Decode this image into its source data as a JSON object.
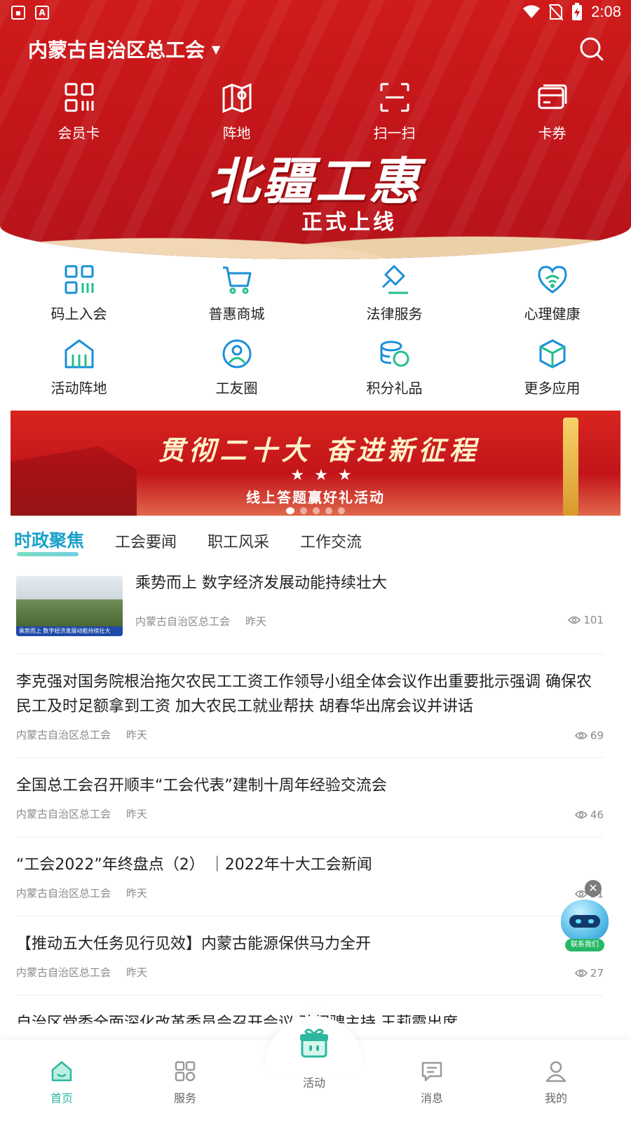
{
  "status_bar": {
    "time": "2:08",
    "icons": [
      "image-icon",
      "font-icon",
      "wifi-icon",
      "no-sim-icon",
      "battery-charging-icon"
    ]
  },
  "header": {
    "org_name": "内蒙古自治区总工会",
    "quick_nav": [
      {
        "label": "会员卡",
        "icon": "member-card-icon"
      },
      {
        "label": "阵地",
        "icon": "map-icon"
      },
      {
        "label": "扫一扫",
        "icon": "scan-icon"
      },
      {
        "label": "卡券",
        "icon": "coupon-icon"
      }
    ],
    "banner": {
      "title": "北疆工惠",
      "subtitle": "正式上线"
    }
  },
  "apps": [
    {
      "label": "码上入会",
      "icon": "qr-join-icon"
    },
    {
      "label": "普惠商城",
      "icon": "cart-icon"
    },
    {
      "label": "法律服务",
      "icon": "gavel-icon"
    },
    {
      "label": "心理健康",
      "icon": "heart-wifi-icon"
    },
    {
      "label": "活动阵地",
      "icon": "venue-icon"
    },
    {
      "label": "工友圈",
      "icon": "community-icon"
    },
    {
      "label": "积分礼品",
      "icon": "points-icon"
    },
    {
      "label": "更多应用",
      "icon": "cube-icon"
    }
  ],
  "promo": {
    "headline": "贯彻二十大 奋进新征程",
    "stars": "★★★",
    "subline": "线上答题赢好礼活动",
    "slide_count": 5,
    "active_slide": 1
  },
  "tabs": [
    {
      "label": "时政聚焦",
      "active": true
    },
    {
      "label": "工会要闻",
      "active": false
    },
    {
      "label": "职工风采",
      "active": false
    },
    {
      "label": "工作交流",
      "active": false
    }
  ],
  "news": [
    {
      "title": "乘势而上 数字经济发展动能持续壮大",
      "source": "内蒙古自治区总工会",
      "time": "昨天",
      "views": "101",
      "thumb_caption": "乘势而上 数字经济发展动能持续壮大"
    },
    {
      "title": "李克强对国务院根治拖欠农民工工资工作领导小组全体会议作出重要批示强调 确保农民工及时足额拿到工资 加大农民工就业帮扶 胡春华出席会议并讲话",
      "source": "内蒙古自治区总工会",
      "time": "昨天",
      "views": "69"
    },
    {
      "title": "全国总工会召开顺丰“工会代表”建制十周年经验交流会",
      "source": "内蒙古自治区总工会",
      "time": "昨天",
      "views": "46"
    },
    {
      "title": "“工会2022”年终盘点（2） ｜2022年十大工会新闻",
      "source": "内蒙古自治区总工会",
      "time": "昨天",
      "views": "31"
    },
    {
      "title": "【推动五大任务见行见效】内蒙古能源保供马力全开",
      "source": "内蒙古自治区总工会",
      "time": "昨天",
      "views": "27"
    },
    {
      "title": "自治区党委全面深化改革委员会召开会议 孙绍骋主持 王莉霞出席"
    }
  ],
  "assistant": {
    "tag": "联系我们",
    "close": "✕"
  },
  "tabbar": [
    {
      "label": "首页",
      "icon": "home-icon",
      "active": true
    },
    {
      "label": "服务",
      "icon": "services-icon",
      "active": false
    },
    {
      "label": "活动",
      "icon": "gift-icon",
      "active": false
    },
    {
      "label": "消息",
      "icon": "message-icon",
      "active": false
    },
    {
      "label": "我的",
      "icon": "profile-icon",
      "active": false
    }
  ],
  "colors": {
    "header_red": "#c4161a",
    "accent_teal": "#2db7a0",
    "tab_active": "#1aa0c9",
    "icon_blue": "#1a8fd8",
    "icon_green": "#22c08a"
  }
}
